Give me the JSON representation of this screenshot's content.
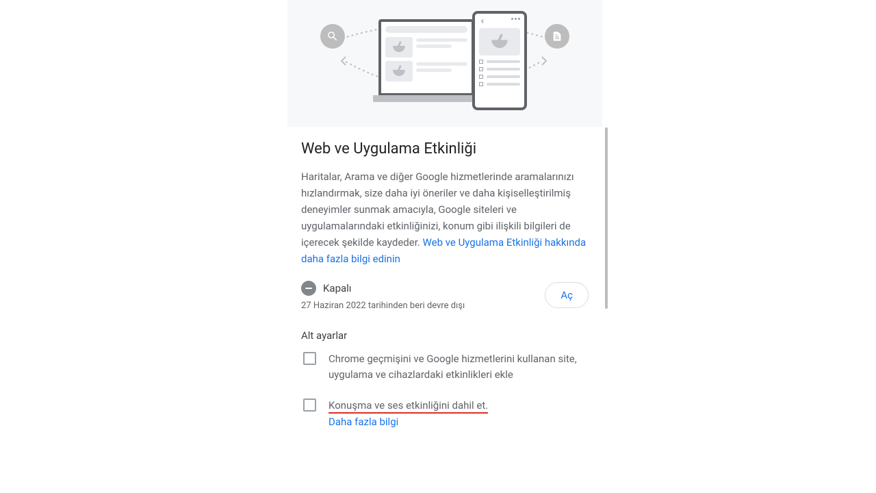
{
  "hero": {
    "search_icon": "search-icon",
    "doc_icon": "document-icon"
  },
  "title": "Web ve Uygulama Etkinliği",
  "description": "Haritalar, Arama ve diğer Google hizmetlerinde aramalarınızı hızlandırmak, size daha iyi öneriler ve daha kişiselleştirilmiş deneyimler sunmak amacıyla, Google siteleri ve uygulamalarındaki etkinliğinizi, konum gibi ilişkili bilgileri de içerecek şekilde kaydeder. ",
  "learn_more_link": "Web ve Uygulama Etkinliği hakkında daha fazla bilgi edinin",
  "status": {
    "label": "Kapalı",
    "since": "27 Haziran 2022 tarihinden beri devre dışı"
  },
  "open_button": "Aç",
  "sub_settings_heading": "Alt ayarlar",
  "checkboxes": [
    {
      "text": "Chrome geçmişini ve Google hizmetlerini kullanan site, uygulama ve cihazlardaki etkinlikleri ekle",
      "highlighted": false,
      "link": null
    },
    {
      "text": "Konuşma ve ses etkinliğini dahil et.",
      "highlighted": true,
      "link": "Daha fazla bilgi"
    }
  ]
}
